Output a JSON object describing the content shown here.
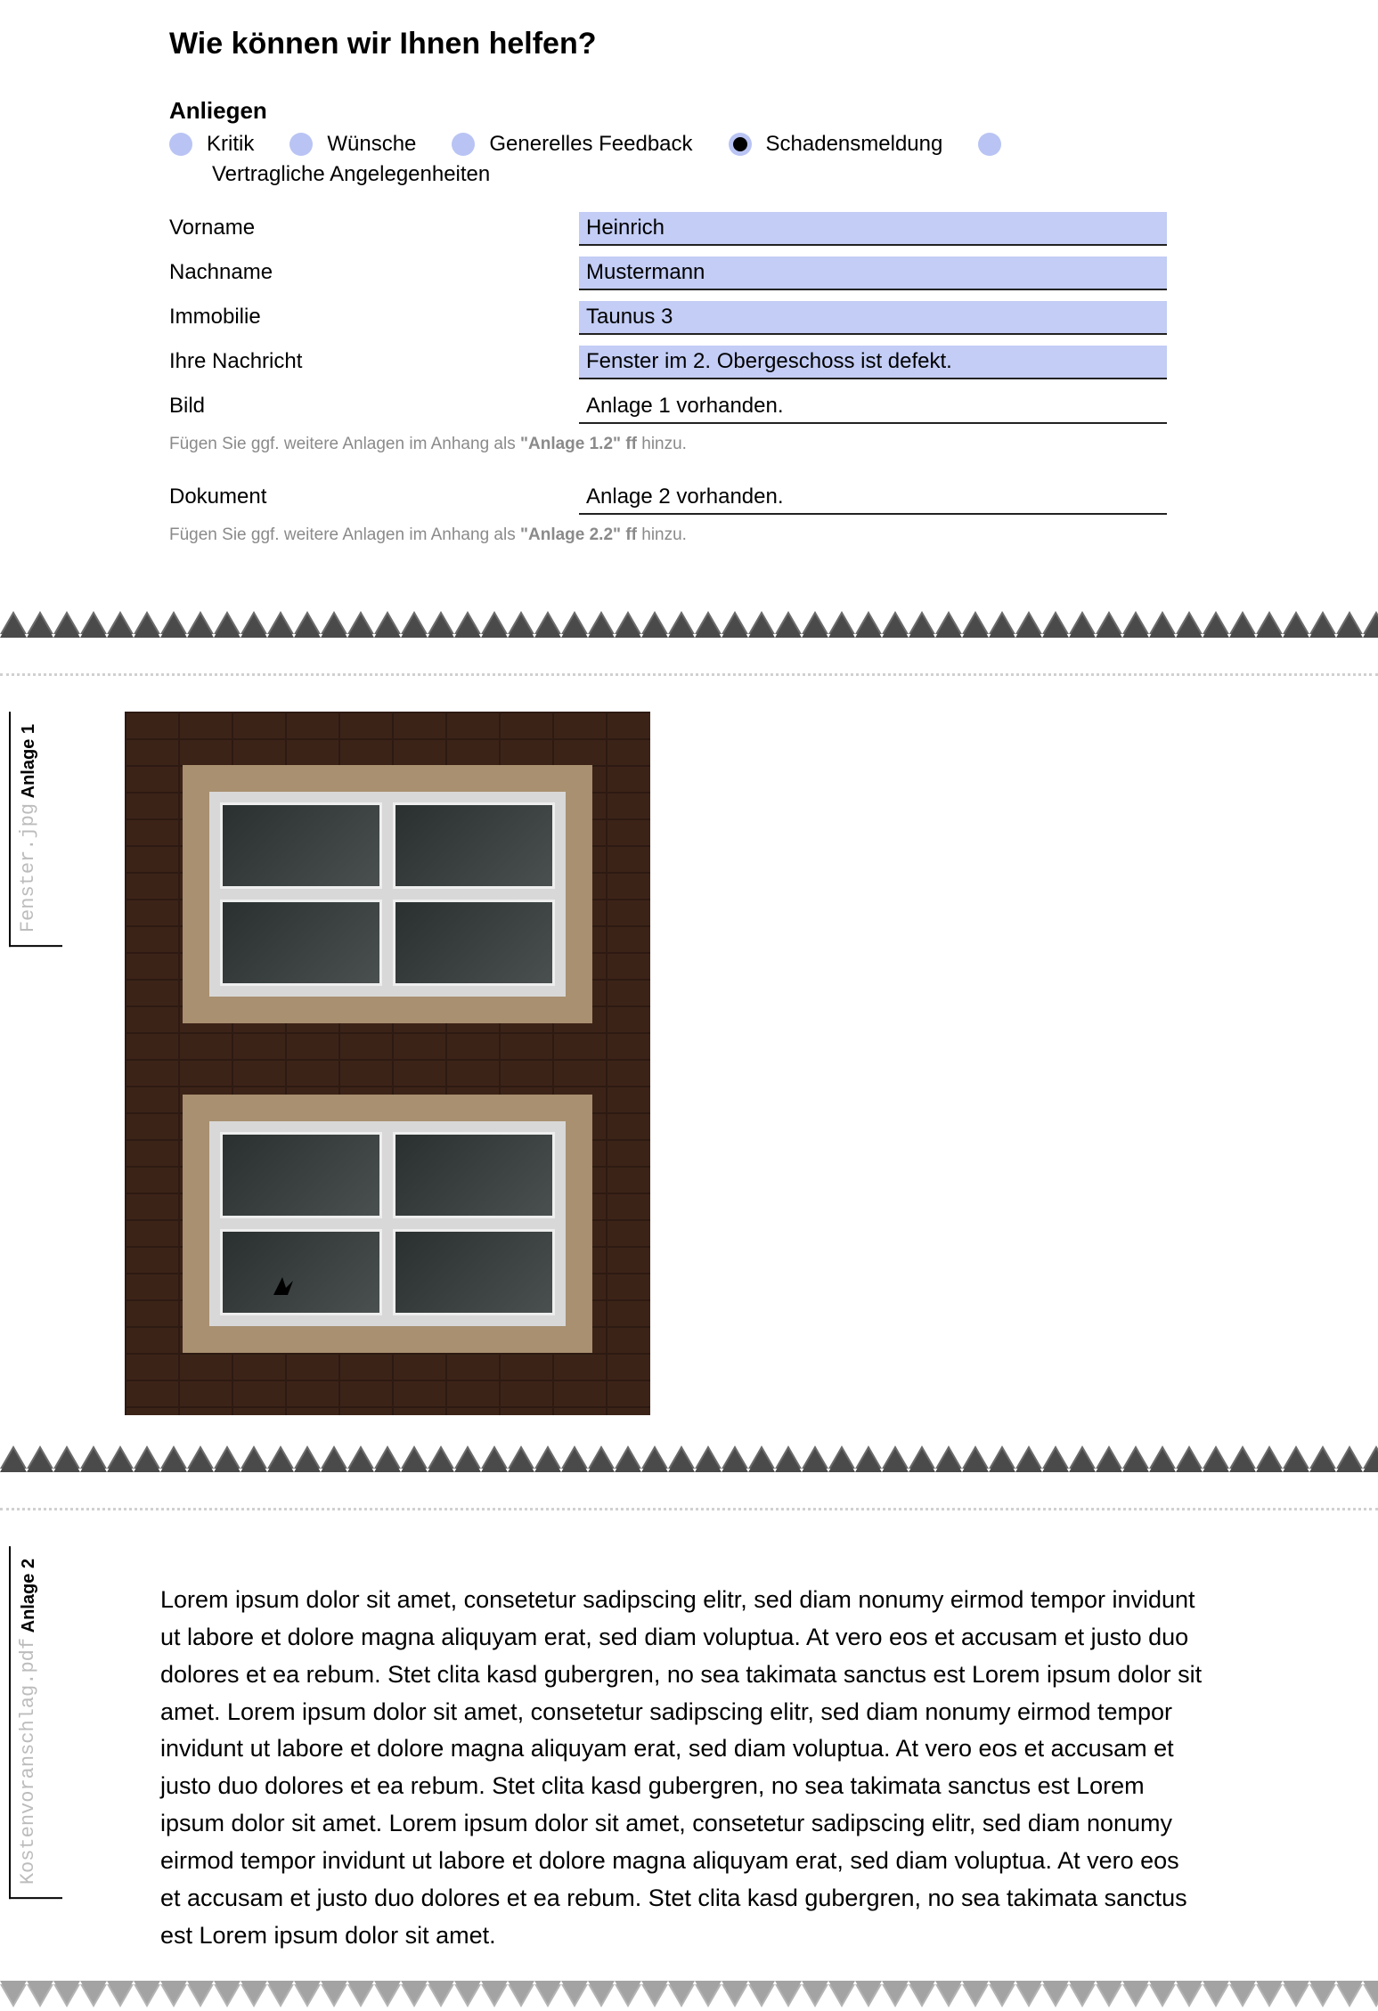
{
  "form": {
    "title": "Wie können wir Ihnen helfen?",
    "anliegen_label": "Anliegen",
    "options": {
      "kritik": "Kritik",
      "wuensche": "Wünsche",
      "generelles": "Generelles Feedback",
      "schaden": "Schadensmeldung",
      "vertrag": "Vertragliche Angelegenheiten"
    },
    "selected_option": "schaden",
    "fields": {
      "vorname_label": "Vorname",
      "vorname_value": "Heinrich",
      "nachname_label": "Nachname",
      "nachname_value": "Mustermann",
      "immobilie_label": "Immobilie",
      "immobilie_value": "Taunus 3",
      "nachricht_label": "Ihre Nachricht",
      "nachricht_value": "Fenster im 2. Obergeschoss ist defekt.",
      "bild_label": "Bild",
      "bild_value": "Anlage 1 vorhanden.",
      "bild_hint_pre": "Fügen Sie ggf. weitere Anlagen im Anhang als ",
      "bild_hint_bold": "\"Anlage 1.2\" ff",
      "bild_hint_post": " hinzu.",
      "dokument_label": "Dokument",
      "dokument_value": "Anlage 2 vorhanden.",
      "dokument_hint_pre": "Fügen Sie ggf. weitere Anlagen im Anhang als ",
      "dokument_hint_bold": "\"Anlage 2.2\" ff",
      "dokument_hint_post": " hinzu."
    }
  },
  "anlage1": {
    "tab_title": "Anlage 1",
    "tab_file": "Fenster.jpg"
  },
  "anlage2": {
    "tab_title": "Anlage 2",
    "tab_file": "Kostenvoranschlag.pdf",
    "body": "Lorem ipsum dolor sit amet, consetetur sadipscing elitr, sed diam nonumy eirmod tempor invidunt ut labore et dolore magna aliquyam erat, sed diam voluptua. At vero eos et accusam et justo duo dolores et ea rebum. Stet clita kasd gubergren, no sea takimata sanctus est Lorem ipsum dolor sit amet. Lorem ipsum dolor sit amet, consetetur sadipscing elitr, sed diam nonumy eirmod tempor invidunt ut labore et dolore magna aliquyam erat, sed diam voluptua. At vero eos et accusam et justo duo dolores et ea rebum. Stet clita kasd gubergren, no sea takimata sanctus est Lorem ipsum dolor sit amet. Lorem ipsum dolor sit amet, consetetur sadipscing elitr, sed diam nonumy eirmod tempor invidunt ut labore et dolore magna aliquyam erat, sed diam voluptua. At vero eos et accusam et justo duo dolores et ea rebum. Stet clita kasd gubergren, no sea takimata sanctus est Lorem ipsum dolor sit amet."
  }
}
